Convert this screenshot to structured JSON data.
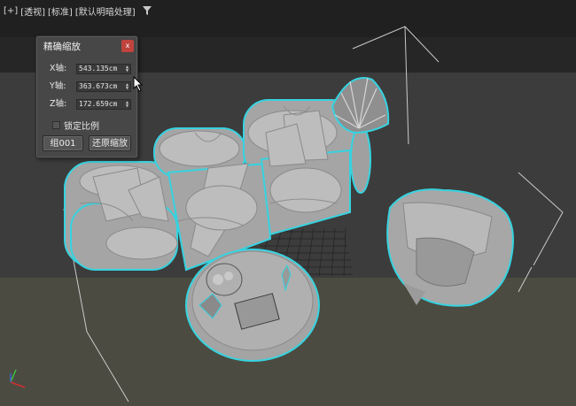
{
  "viewport": {
    "labels": [
      "[+]",
      "[透视]",
      "[标准]",
      "[默认明暗处理]"
    ]
  },
  "dialog": {
    "title": "精确缩放",
    "close_label": "x",
    "axes": [
      {
        "label": "X轴:",
        "value": "543.135cm"
      },
      {
        "label": "Y轴:",
        "value": "363.673cm"
      },
      {
        "label": "Z轴:",
        "value": "172.659cm"
      }
    ],
    "lock_label": "锁定比例",
    "lock_checked": false,
    "group_button": "组001",
    "reset_button": "还原缩放"
  },
  "colors": {
    "selection_outline": "#36d3e0",
    "wireframe": "#d8d8d8",
    "model": "#a9a9a9",
    "close_button": "#c0433d"
  }
}
